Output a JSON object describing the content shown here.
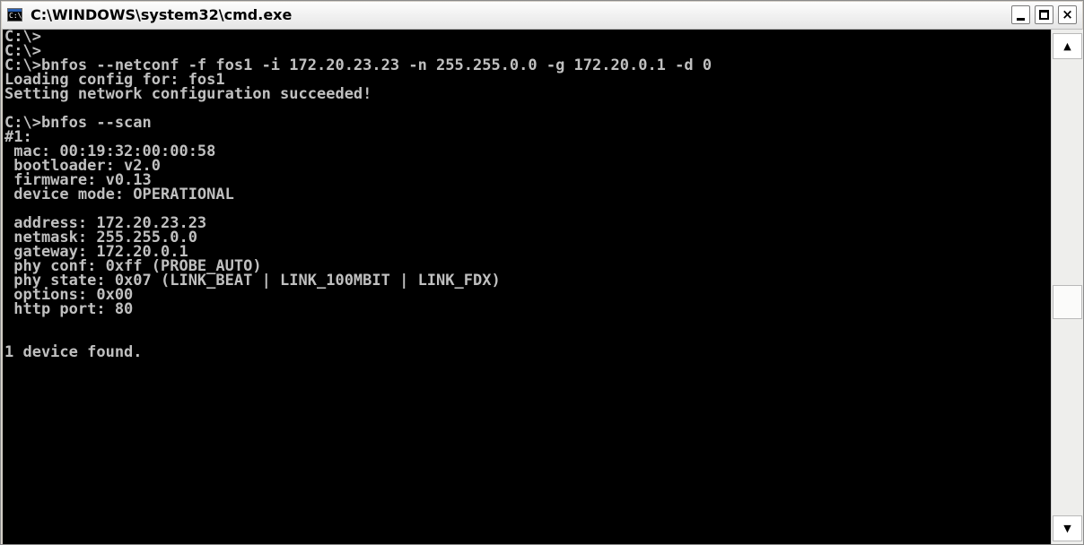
{
  "window": {
    "title": "C:\\WINDOWS\\system32\\cmd.exe",
    "app_icon": "console-icon",
    "app_icon_glyph": "C:\\",
    "controls": {
      "minimize": "minimize-icon",
      "maximize": "maximize-icon",
      "close_label": "×"
    }
  },
  "console": {
    "lines": [
      "C:\\>",
      "C:\\>",
      "C:\\>bnfos --netconf -f fos1 -i 172.20.23.23 -n 255.255.0.0 -g 172.20.0.1 -d 0",
      "Loading config for: fos1",
      "Setting network configuration succeeded!",
      "",
      "C:\\>bnfos --scan",
      "#1:",
      " mac: 00:19:32:00:00:58",
      " bootloader: v2.0",
      " firmware: v0.13",
      " device mode: OPERATIONAL",
      "",
      " address: 172.20.23.23",
      " netmask: 255.255.0.0",
      " gateway: 172.20.0.1",
      " phy conf: 0xff (PROBE_AUTO)",
      " phy state: 0x07 (LINK_BEAT | LINK_100MBIT | LINK_FDX)",
      " options: 0x00",
      " http port: 80",
      "",
      "",
      "1 device found."
    ]
  },
  "scrollbar": {
    "up_arrow": "▲",
    "down_arrow": "▼",
    "position": 0.5
  },
  "colors": {
    "console_background": "#000000",
    "console_text": "#c0c0c0"
  }
}
